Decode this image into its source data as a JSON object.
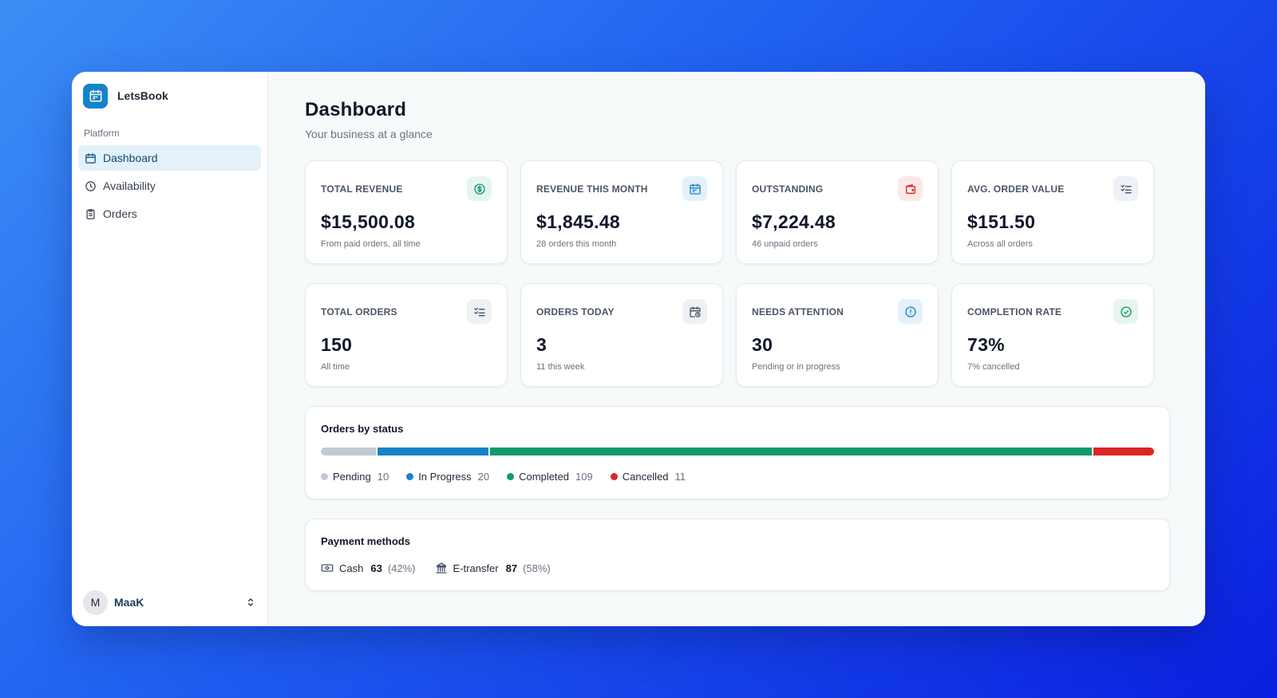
{
  "brand": {
    "name": "LetsBook",
    "color": "#1683c8"
  },
  "sidebar": {
    "section": "Platform",
    "items": [
      {
        "label": "Dashboard",
        "icon": "calendar-icon",
        "active": true
      },
      {
        "label": "Availability",
        "icon": "clock-icon",
        "active": false
      },
      {
        "label": "Orders",
        "icon": "clipboard-icon",
        "active": false
      }
    ]
  },
  "user": {
    "initial": "M",
    "name": "MaaK"
  },
  "header": {
    "title": "Dashboard",
    "subtitle": "Your business at a glance"
  },
  "stats": [
    {
      "label": "TOTAL REVENUE",
      "value": "$15,500.08",
      "sub": "From paid orders, all time",
      "icon": "dollar-circle-icon",
      "icon_bg": "#e6f6ee",
      "icon_color": "#0f9b63"
    },
    {
      "label": "REVENUE THIS MONTH",
      "value": "$1,845.48",
      "sub": "28 orders this month",
      "icon": "calendar-icon",
      "icon_bg": "#e4f1fa",
      "icon_color": "#1683c8"
    },
    {
      "label": "OUTSTANDING",
      "value": "$7,224.48",
      "sub": "46 unpaid orders",
      "icon": "wallet-icon",
      "icon_bg": "#fde8e8",
      "icon_color": "#dc2626"
    },
    {
      "label": "AVG. ORDER VALUE",
      "value": "$151.50",
      "sub": "Across all orders",
      "icon": "list-check-icon",
      "icon_bg": "#eef1f5",
      "icon_color": "#475569"
    },
    {
      "label": "TOTAL ORDERS",
      "value": "150",
      "sub": "All time",
      "icon": "list-check-icon",
      "icon_bg": "#eef1f5",
      "icon_color": "#475569"
    },
    {
      "label": "ORDERS TODAY",
      "value": "3",
      "sub": "11 this week",
      "icon": "calendar-clock-icon",
      "icon_bg": "#eef1f5",
      "icon_color": "#475569"
    },
    {
      "label": "NEEDS ATTENTION",
      "value": "30",
      "sub": "Pending or in progress",
      "icon": "alert-circle-icon",
      "icon_bg": "#e4f1fa",
      "icon_color": "#1683c8"
    },
    {
      "label": "COMPLETION RATE",
      "value": "73%",
      "sub": "7% cancelled",
      "icon": "check-circle-icon",
      "icon_bg": "#e6f6ee",
      "icon_color": "#0f9b63"
    }
  ],
  "orders_by_status": {
    "title": "Orders by status",
    "statuses": [
      {
        "label": "Pending",
        "count": 10,
        "color": "#c3cad3"
      },
      {
        "label": "In Progress",
        "count": 20,
        "color": "#1683c8"
      },
      {
        "label": "Completed",
        "count": 109,
        "color": "#0f9b6c"
      },
      {
        "label": "Cancelled",
        "count": 11,
        "color": "#dc2626"
      }
    ]
  },
  "payment_methods": {
    "title": "Payment methods",
    "methods": [
      {
        "label": "Cash",
        "count": "63",
        "pct": "(42%)",
        "icon": "cash-icon"
      },
      {
        "label": "E-transfer",
        "count": "87",
        "pct": "(58%)",
        "icon": "bank-icon"
      }
    ]
  }
}
